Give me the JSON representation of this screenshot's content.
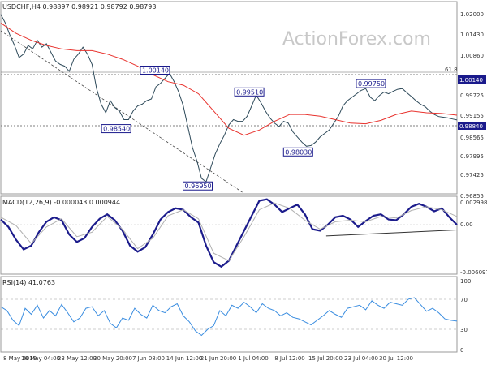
{
  "watermark": "ActionForex.com",
  "colors": {
    "price": "#2e4a5a",
    "ma": "#e8322d",
    "macd": "#1c1c8c",
    "signal": "#b0b0b0",
    "rsi": "#3a8de0",
    "frame": "#9a9a9a",
    "annotation": "#1a1a8c",
    "current_badge_bg": "#1a1a8c"
  },
  "chart_data": [
    {
      "type": "line",
      "title": "USDCHF,H4  0.98897 0.98921 0.98792 0.98793",
      "x_tick_labels": [
        "8 May 2019",
        "16 May 04:00",
        "23 May 12:00",
        "30 May 20:00",
        "7 Jun 08:00",
        "14 Jun 12:00",
        "21 Jun 20:00",
        "1 Jul 04:00",
        "8 Jul 12:00",
        "15 Jul 20:00",
        "23 Jul 04:00",
        "30 Jul 12:00"
      ],
      "y_tick_labels": [
        "1.02000",
        "1.01430",
        "1.00860",
        "0.99725",
        "0.99155",
        "0.98565",
        "0.97995",
        "0.97425",
        "0.96855"
      ],
      "ylim": [
        0.9665,
        1.0222
      ],
      "grid": false,
      "series": [
        {
          "name": "USDCHF",
          "x": [
            0,
            3,
            6,
            9,
            12,
            15,
            18,
            21,
            24,
            27,
            30,
            33,
            36,
            39,
            42,
            45,
            48,
            51,
            54,
            57,
            60,
            63,
            66,
            69,
            72,
            75,
            78,
            81,
            84,
            87,
            90,
            93,
            96,
            99,
            102,
            105,
            108,
            111,
            114,
            117,
            120,
            123,
            126,
            129,
            132,
            135,
            138,
            141,
            144,
            147,
            150,
            153,
            156,
            159,
            162,
            165,
            168,
            171,
            174,
            177,
            180,
            183,
            186,
            189,
            192,
            195,
            198,
            201,
            204,
            207,
            210,
            213,
            216,
            219,
            222,
            225,
            228,
            231,
            234,
            237,
            240,
            243,
            246,
            249,
            252,
            255,
            258,
            261,
            264,
            267,
            270,
            273,
            276,
            279,
            282,
            285,
            288,
            291,
            294,
            297,
            300
          ],
          "values": [
            1.0185,
            1.016,
            1.0125,
            1.0095,
            1.006,
            1.007,
            1.0095,
            1.0085,
            1.011,
            1.009,
            1.01,
            1.0075,
            1.005,
            1.004,
            1.0035,
            1.002,
            1.0055,
            1.007,
            1.009,
            1.007,
            1.004,
            0.997,
            0.9925,
            0.99,
            0.9935,
            0.9915,
            0.9905,
            0.988,
            0.988,
            0.9905,
            0.992,
            0.9925,
            0.9935,
            0.994,
            0.9975,
            0.9985,
            1.0,
            1.0014,
            0.999,
            0.996,
            0.992,
            0.986,
            0.98,
            0.976,
            0.971,
            0.97,
            0.974,
            0.978,
            0.981,
            0.9835,
            0.9865,
            0.988,
            0.9875,
            0.9875,
            0.989,
            0.992,
            0.9951,
            0.993,
            0.9905,
            0.9885,
            0.987,
            0.986,
            0.9875,
            0.987,
            0.9845,
            0.983,
            0.9815,
            0.9803,
            0.9805,
            0.9815,
            0.983,
            0.984,
            0.985,
            0.987,
            0.989,
            0.992,
            0.9935,
            0.9945,
            0.9955,
            0.9965,
            0.997,
            0.9945,
            0.9935,
            0.995,
            0.996,
            0.9955,
            0.9962,
            0.9968,
            0.997,
            0.9958,
            0.9947,
            0.9935,
            0.9925,
            0.9918,
            0.9905,
            0.9895,
            0.9889,
            0.9887,
            0.9885,
            0.9882,
            0.9879
          ]
        },
        {
          "name": "MA",
          "x": [
            0,
            10,
            20,
            30,
            40,
            50,
            60,
            70,
            80,
            90,
            100,
            110,
            120,
            130,
            140,
            150,
            160,
            170,
            180,
            190,
            200,
            210,
            220,
            230,
            240,
            250,
            260,
            270,
            280,
            290,
            300
          ],
          "values": [
            1.016,
            1.013,
            1.011,
            1.0095,
            1.0085,
            1.008,
            1.008,
            1.007,
            1.0055,
            1.0035,
            1.001,
            0.999,
            0.998,
            0.9955,
            0.9905,
            0.9855,
            0.9835,
            0.985,
            0.9875,
            0.9895,
            0.9895,
            0.989,
            0.988,
            0.987,
            0.9868,
            0.9878,
            0.9895,
            0.9905,
            0.99,
            0.9898,
            0.9893
          ]
        }
      ],
      "annotations": [
        {
          "text": "1.00140",
          "x": 111,
          "y": 1.0014
        },
        {
          "text": "0.98540",
          "x": 86,
          "y": 0.9854
        },
        {
          "text": "0.96950",
          "x": 138,
          "y": 0.9695
        },
        {
          "text": "0.99510",
          "x": 173,
          "y": 0.9951
        },
        {
          "text": "0.98030",
          "x": 203,
          "y": 0.9803
        },
        {
          "text": "0.99750",
          "x": 253,
          "y": 0.9975
        }
      ],
      "current_price_label": "0.98840",
      "level_label": "1.00140",
      "fib_label": "61.8"
    },
    {
      "type": "line",
      "title": "MACD(12,26,9) -0.000043 0.000944",
      "y_tick_labels": [
        "0.002998",
        "0.00",
        "-0.006097"
      ],
      "ylim": [
        -0.0068,
        0.0036
      ],
      "series": [
        {
          "name": "MACD",
          "x": [
            0,
            5,
            10,
            15,
            20,
            25,
            30,
            35,
            40,
            45,
            50,
            55,
            60,
            65,
            70,
            75,
            80,
            85,
            90,
            95,
            100,
            105,
            110,
            115,
            120,
            125,
            130,
            135,
            140,
            145,
            150,
            155,
            160,
            165,
            170,
            175,
            180,
            185,
            190,
            195,
            200,
            205,
            210,
            215,
            220,
            225,
            230,
            235,
            240,
            245,
            250,
            255,
            260,
            265,
            270,
            275,
            280,
            285,
            290,
            295,
            300
          ],
          "values": [
            0.0005,
            -0.0005,
            -0.0022,
            -0.0035,
            -0.003,
            -0.0012,
            0.0002,
            0.0008,
            0.0004,
            -0.0015,
            -0.0025,
            -0.002,
            -0.0005,
            0.0006,
            0.0012,
            0.0004,
            -0.001,
            -0.003,
            -0.0038,
            -0.0032,
            -0.0015,
            0.0005,
            0.0015,
            0.002,
            0.0018,
            0.0008,
            0.0001,
            -0.003,
            -0.0052,
            -0.0058,
            -0.005,
            -0.003,
            -0.001,
            0.001,
            0.003,
            0.0032,
            0.0025,
            0.0015,
            0.002,
            0.0025,
            0.0012,
            -0.0008,
            -0.001,
            -0.0002,
            0.0008,
            0.001,
            0.0005,
            -0.0005,
            0.0003,
            0.001,
            0.0012,
            0.0005,
            0.0004,
            0.0012,
            0.0022,
            0.0026,
            0.0022,
            0.0016,
            0.002,
            0.0008,
            -0.0002
          ]
        },
        {
          "name": "Signal",
          "x": [
            0,
            10,
            20,
            30,
            40,
            50,
            60,
            70,
            80,
            90,
            100,
            110,
            120,
            130,
            140,
            150,
            160,
            170,
            180,
            190,
            200,
            210,
            220,
            230,
            240,
            250,
            260,
            270,
            280,
            290,
            300
          ],
          "values": [
            0.0008,
            -0.0003,
            -0.0027,
            -0.0005,
            0.0006,
            -0.0018,
            -0.0012,
            0.0009,
            -0.0008,
            -0.0034,
            -0.002,
            0.001,
            0.0018,
            0.0006,
            -0.004,
            -0.005,
            -0.0018,
            0.0018,
            0.0027,
            0.002,
            0.0004,
            -0.0008,
            0.0002,
            0.0004,
            0.0002,
            0.0009,
            0.0007,
            0.0017,
            0.0022,
            0.0018,
            0.0009
          ]
        },
        {
          "name": "Trendline",
          "x": [
            214,
            300
          ],
          "values": [
            -0.0017,
            -0.0009
          ]
        }
      ]
    },
    {
      "type": "line",
      "title": "RSI(14) 41.0763",
      "y_tick_labels": [
        "100",
        "70",
        "30",
        "0"
      ],
      "ylim": [
        0,
        100
      ],
      "series": [
        {
          "name": "RSI",
          "x": [
            0,
            4,
            8,
            12,
            16,
            20,
            24,
            28,
            32,
            36,
            40,
            44,
            48,
            52,
            56,
            60,
            64,
            68,
            72,
            76,
            80,
            84,
            88,
            92,
            96,
            100,
            104,
            108,
            112,
            116,
            120,
            124,
            128,
            132,
            136,
            140,
            144,
            148,
            152,
            156,
            160,
            164,
            168,
            172,
            176,
            180,
            184,
            188,
            192,
            196,
            200,
            204,
            208,
            212,
            216,
            220,
            224,
            228,
            232,
            236,
            240,
            244,
            248,
            252,
            256,
            260,
            264,
            268,
            272,
            276,
            280,
            284,
            288,
            292,
            296,
            300
          ],
          "values": [
            60,
            55,
            42,
            35,
            58,
            50,
            62,
            45,
            55,
            48,
            63,
            52,
            40,
            45,
            58,
            60,
            48,
            55,
            38,
            32,
            45,
            42,
            58,
            50,
            45,
            62,
            55,
            52,
            60,
            64,
            48,
            40,
            28,
            22,
            30,
            35,
            55,
            48,
            62,
            58,
            66,
            60,
            52,
            64,
            58,
            55,
            48,
            52,
            46,
            44,
            40,
            36,
            42,
            48,
            55,
            50,
            46,
            58,
            60,
            62,
            56,
            68,
            62,
            58,
            66,
            64,
            62,
            70,
            72,
            63,
            54,
            58,
            52,
            44,
            42,
            41
          ]
        }
      ]
    }
  ]
}
